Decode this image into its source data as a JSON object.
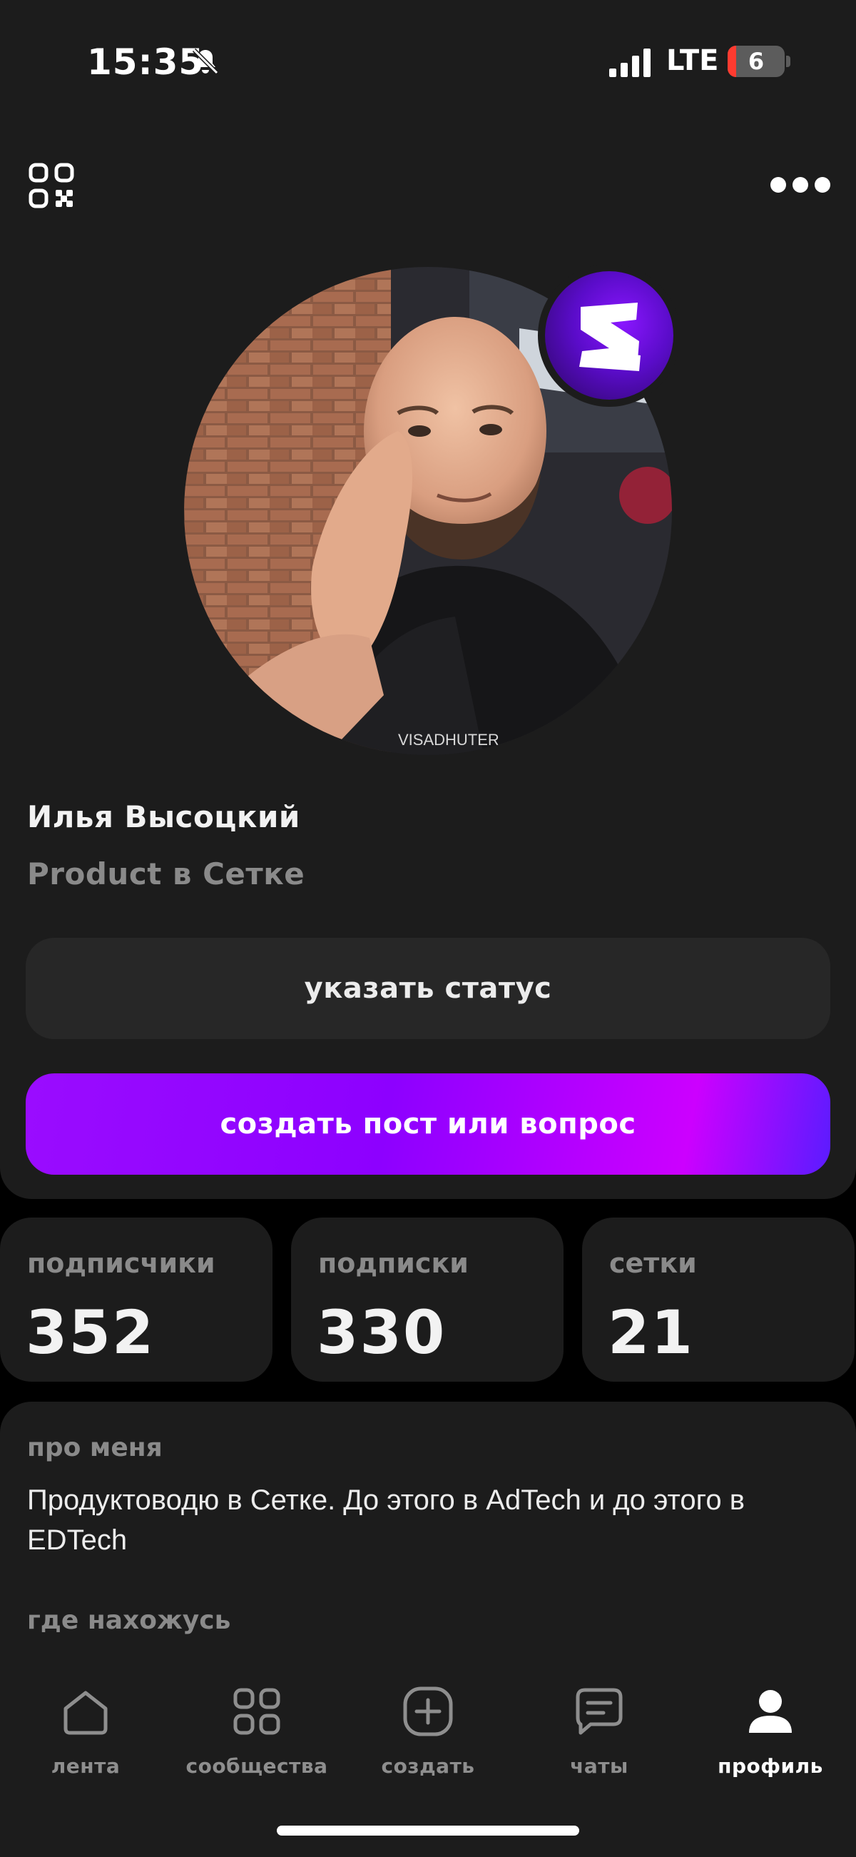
{
  "status_bar": {
    "time": "15:35",
    "network": "LTE",
    "battery": "6",
    "icons": [
      "bell-off-icon",
      "signal-icon",
      "battery-icon"
    ]
  },
  "header": {
    "icons": [
      "qr-code-icon",
      "more-icon"
    ]
  },
  "profile": {
    "name": "Илья Высоцкий",
    "job": "Product в Сетке",
    "badge_icon": "setka-logo-icon"
  },
  "actions": {
    "status_label": "указать статус",
    "create_post_label": "создать пост или вопрос"
  },
  "stats": [
    {
      "label": "подписчики",
      "value": "352"
    },
    {
      "label": "подписки",
      "value": "330"
    },
    {
      "label": "сетки",
      "value": "21"
    }
  ],
  "about": {
    "title": "про меня",
    "text": "Продуктоводю в Сетке. До этого в AdTech и до этого в EDTech",
    "location_title": "где нахожусь"
  },
  "tabs": [
    {
      "label": "лента",
      "icon": "home-icon",
      "active": false
    },
    {
      "label": "сообщества",
      "icon": "grid-icon",
      "active": false
    },
    {
      "label": "создать",
      "icon": "plus-square-icon",
      "active": false
    },
    {
      "label": "чаты",
      "icon": "chat-icon",
      "active": false
    },
    {
      "label": "профиль",
      "icon": "profile-icon",
      "active": true
    }
  ],
  "colors": {
    "accent_gradient_start": "#8d00ff",
    "accent_gradient_end": "#cc00ff",
    "background": "#1c1c1c",
    "card": "#272727",
    "muted_text": "#8a8a8a"
  }
}
